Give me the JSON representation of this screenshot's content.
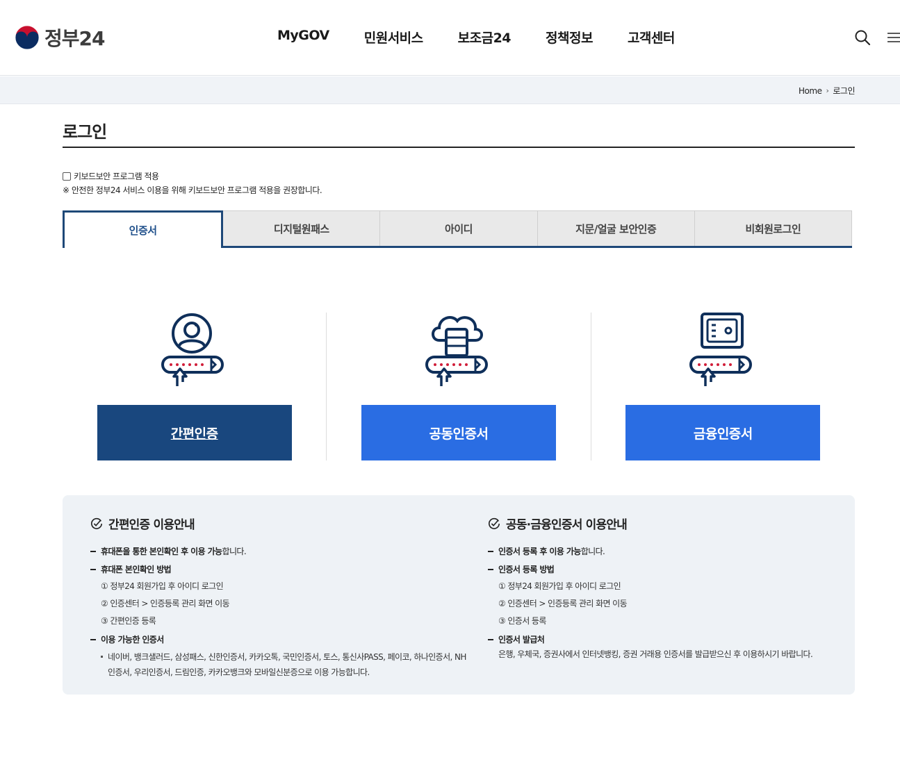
{
  "header": {
    "logo_text": "정부24",
    "nav": [
      "MyGOV",
      "민원서비스",
      "보조금24",
      "정책정보",
      "고객센터"
    ],
    "icons": [
      "search-icon",
      "menu-icon"
    ]
  },
  "breadcrumb": {
    "home": "Home",
    "current": "로그인"
  },
  "page": {
    "title": "로그인"
  },
  "keyboard": {
    "label": "키보드보안 프로그램 적용",
    "checked": false,
    "notice": "※ 안전한 정부24 서비스 이용을 위해 키보드보안 프로그램 적용을 권장합니다."
  },
  "tabs": [
    {
      "label": "인증서",
      "active": true
    },
    {
      "label": "디지털원패스",
      "active": false
    },
    {
      "label": "아이디",
      "active": false
    },
    {
      "label": "지문/얼굴 보안인증",
      "active": false
    },
    {
      "label": "비회원로그인",
      "active": false
    }
  ],
  "methods": [
    {
      "label": "간편인증",
      "icon": "person-badge-icon",
      "color": "#19477e"
    },
    {
      "label": "공동인증서",
      "icon": "cloud-server-icon",
      "color": "#2a6de3"
    },
    {
      "label": "금융인증서",
      "icon": "safe-icon",
      "color": "#2a6de3"
    }
  ],
  "guide": {
    "simple": {
      "title": "간편인증 이용안내",
      "item1_bold": "휴대폰을 통한 본인확인 후 이용 가능",
      "item1_rest": "합니다.",
      "item2_bold": "휴대폰 본인확인 방법",
      "steps": [
        "① 정부24 회원가입 후 아이디 로그인",
        "② 인증센터 > 인증등록 관리 화면 이동",
        "③ 간편인증 등록"
      ],
      "item3_bold": "이용 가능한 인증서",
      "providers": "네이버, 뱅크샐러드, 삼성패스, 신한인증서, 카카오톡, 국민인증서, 토스, 통신사PASS, 페이코, 하나인증서, NH인증서, 우리인증서, 드림인증, 카카오뱅크와 모바일신분증으로 이용 가능합니다."
    },
    "joint": {
      "title": "공동·금융인증서 이용안내",
      "item1_bold": "인증서 등록 후 이용 가능",
      "item1_rest": "합니다.",
      "item2_bold": "인증서 등록 방법",
      "steps": [
        "① 정부24 회원가입 후 아이디 로그인",
        "② 인증센터 > 인증등록 관리 화면 이동",
        "③ 인증서 등록"
      ],
      "item3_bold": "인증서 발급처",
      "issuers": "은행, 우체국, 증권사에서 인터넷뱅킹, 증권 거래용 인증서를 발급받으신 후 이용하시기 바랍니다."
    }
  }
}
